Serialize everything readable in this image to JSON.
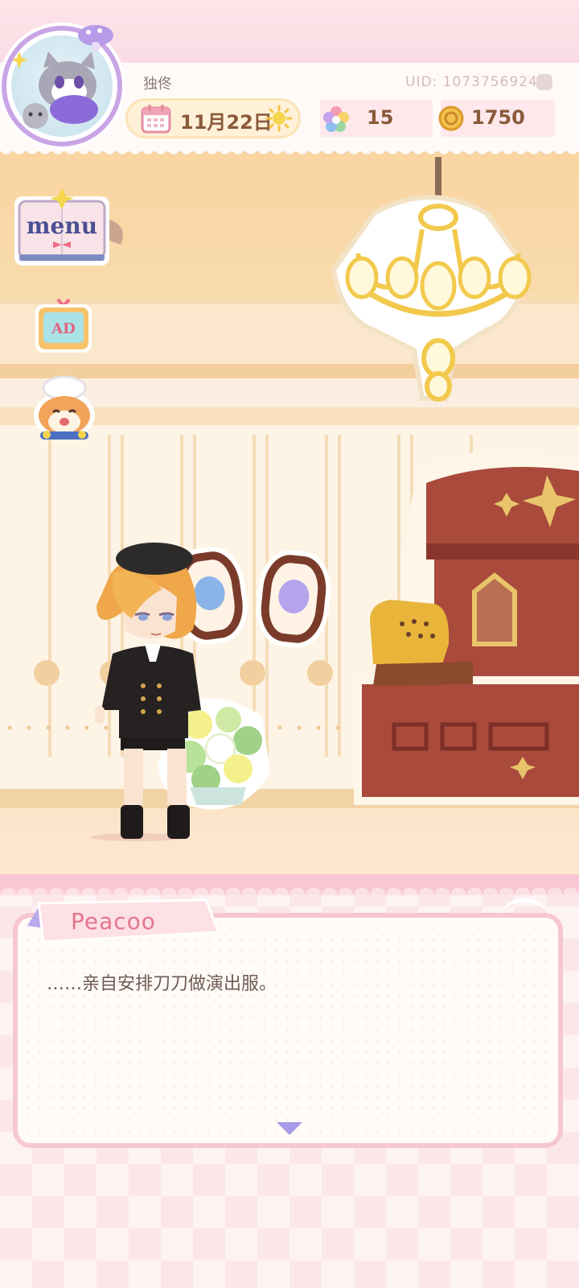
{
  "hud": {
    "username": "独佟",
    "date": "11月22日",
    "uid": "UID: 1073756924",
    "gems": "15",
    "coins": "1750"
  },
  "side_buttons": {
    "menu_label": "menu",
    "ad_label": "AD"
  },
  "dialog": {
    "speaker": "Peacoo",
    "text": "……亲自安排刀刀做演出服。"
  },
  "colors": {
    "pink_accent": "#f7c7d1",
    "speaker_pink": "#e3768c",
    "arrow_purple": "#a79ae6",
    "wood_brown": "#7a3b2a",
    "gold": "#f2c94c"
  },
  "icons": {
    "calendar": "calendar-icon",
    "sun": "sun-icon",
    "gem": "rainbow-flower-icon",
    "coin": "coin-icon",
    "copy": "copy-icon",
    "continue": "triangle-down-icon"
  }
}
